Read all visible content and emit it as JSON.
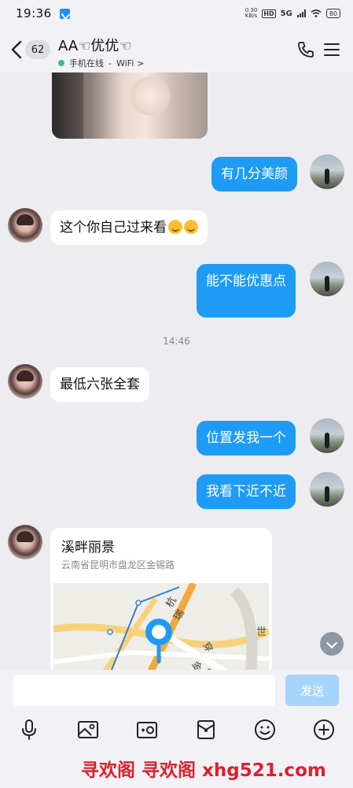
{
  "status_bar": {
    "time": "19:36",
    "net_speed": "0.30",
    "net_unit": "KB/s",
    "hd_label": "HD",
    "signal_label": "5G",
    "battery": "80"
  },
  "header": {
    "unread_count": "62",
    "contact_name": "AA☜优优☜",
    "online_status": "手机在线",
    "separator": "-",
    "network": "WiFi",
    "status_chevron": ">"
  },
  "messages": [
    {
      "side": "out",
      "text": "有几分美颜"
    },
    {
      "side": "in",
      "text": "这个你自己过来看"
    },
    {
      "side": "out",
      "text": "能不能优惠点"
    },
    {
      "side": "in",
      "text": "最低六张全套"
    },
    {
      "side": "out",
      "text": "位置发我一个"
    },
    {
      "side": "out",
      "text": "我看下近不近"
    }
  ],
  "timestamp": "14:46",
  "location": {
    "title": "溪畔丽景",
    "address": "云南省昆明市盘龙区金锡路",
    "map_labels": [
      "杭",
      "瑞",
      "穿",
      "金",
      "路",
      "世"
    ]
  },
  "input": {
    "placeholder": "",
    "send_label": "发送"
  },
  "toolbar": [
    "mic-icon",
    "image-icon",
    "camera-icon",
    "gift-icon",
    "emoji-icon",
    "plus-icon"
  ],
  "watermark": "寻欢阁 寻欢阁 xhg521.com",
  "colors": {
    "accent": "#1e9bf5",
    "online": "#36c275",
    "watermark": "#e11d2c"
  }
}
